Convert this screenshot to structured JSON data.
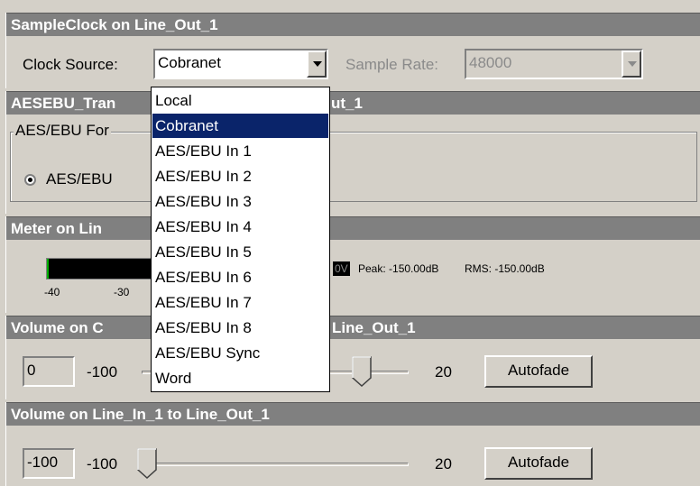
{
  "sample_clock": {
    "title": "SampleClock on Line_Out_1",
    "clock_source_label": "Clock Source:",
    "clock_source_value": "Cobranet",
    "sample_rate_label": "Sample Rate:",
    "sample_rate_value": "48000"
  },
  "aesebu": {
    "title_visible_left": "AESEBU_Tran",
    "title_visible_right": "ut_1",
    "group_label": "AES/EBU For",
    "radio_label": "AES/EBU",
    "radio_selected": true
  },
  "meter": {
    "title_visible": "Meter on Lin",
    "scale_left": [
      "-40",
      "-30"
    ],
    "clip_label": "0V",
    "peak_text": "Peak: -150.00dB",
    "rms_text": "RMS: -150.00dB",
    "level_fraction": 0.02,
    "level_color": "#00b000"
  },
  "volume_1": {
    "title_left": "Volume on C",
    "title_right": "Line_Out_1",
    "value": "0",
    "min_label": "-100",
    "max_label": "20",
    "autofade_label": "Autofade",
    "slider_value": 0
  },
  "volume_2": {
    "title": "Volume on Line_In_1 to Line_Out_1",
    "value": "-100",
    "min_label": "-100",
    "max_label": "20",
    "autofade_label": "Autofade",
    "slider_value": -100
  },
  "dropdown": {
    "options": [
      "Local",
      "Cobranet",
      "AES/EBU In 1",
      "AES/EBU In 2",
      "AES/EBU In 3",
      "AES/EBU In 4",
      "AES/EBU In 5",
      "AES/EBU In 6",
      "AES/EBU In 7",
      "AES/EBU In 8",
      "AES/EBU Sync",
      "Word"
    ],
    "selected_index": 1
  },
  "colors": {
    "panel_bg": "#d4d0c8",
    "header_bg": "#808080",
    "selection_bg": "#0a246a"
  }
}
